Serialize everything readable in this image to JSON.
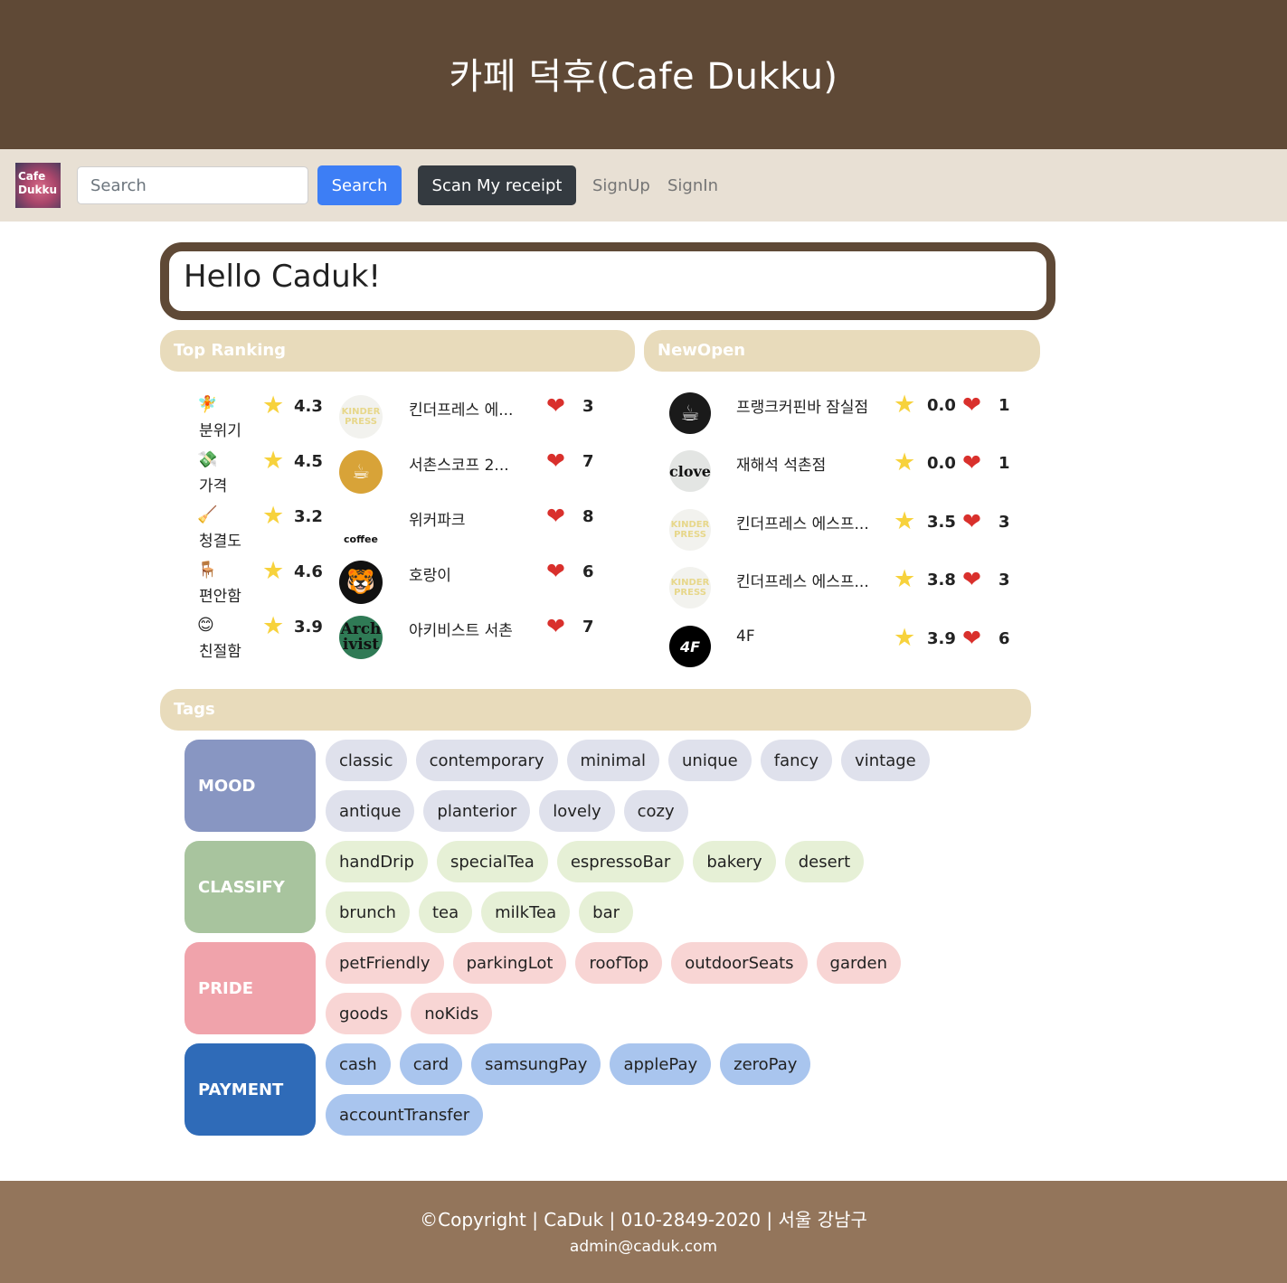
{
  "header": {
    "title": "카페 덕후(Cafe Dukku)"
  },
  "navbar": {
    "logo_text": "Cafe Dukku",
    "search_placeholder": "Search",
    "search_button": "Search",
    "scan_button": "Scan My receipt",
    "signup": "SignUp",
    "signin": "SignIn"
  },
  "greeting": "Hello Caduk!",
  "sections": {
    "top_ranking": "Top Ranking",
    "new_open": "NewOpen",
    "tags": "Tags"
  },
  "categories": [
    {
      "icon": "fairy-icon",
      "glyph": "🧚",
      "label": "분위기",
      "score": "4.3"
    },
    {
      "icon": "money-icon",
      "glyph": "💸",
      "label": "가격",
      "score": "4.5"
    },
    {
      "icon": "broom-icon",
      "glyph": "🧹",
      "label": "청결도",
      "score": "3.2"
    },
    {
      "icon": "chair-icon",
      "glyph": "🪑",
      "label": "편안함",
      "score": "4.6"
    },
    {
      "icon": "smile-icon",
      "glyph": "😊",
      "label": "친절함",
      "score": "3.9"
    }
  ],
  "top_ranking": [
    {
      "name": "킨더프레스 에...",
      "likes": "3",
      "img": "kinder-press-logo",
      "img_text": "KINDER PRESS"
    },
    {
      "name": "서촌스코프 2...",
      "likes": "7",
      "img": "seochon-scope-logo",
      "img_text": "☕"
    },
    {
      "name": "위커파크",
      "likes": "8",
      "img": "wicker-park-logo",
      "img_text": "coffee"
    },
    {
      "name": "호랑이",
      "likes": "6",
      "img": "tiger-logo",
      "img_text": "🐯"
    },
    {
      "name": "아키비스트 서촌",
      "likes": "7",
      "img": "archivist-logo",
      "img_text": "Arch ivist"
    }
  ],
  "new_open": [
    {
      "name": "프랭크커핀바 잠실점",
      "score": "0.0",
      "likes": "1",
      "img": "frank-coffee-logo",
      "img_text": "☕"
    },
    {
      "name": "재해석 석촌점",
      "score": "0.0",
      "likes": "1",
      "img": "clove-logo",
      "img_text": "clove"
    },
    {
      "name": "킨더프레스 에스프...",
      "score": "3.5",
      "likes": "3",
      "img": "kinder-press-logo",
      "img_text": "KINDER PRESS"
    },
    {
      "name": "킨더프레스 에스프...",
      "score": "3.8",
      "likes": "3",
      "img": "kinder-press-logo",
      "img_text": "KINDER PRESS"
    },
    {
      "name": "4F",
      "score": "3.9",
      "likes": "6",
      "img": "4f-logo",
      "img_text": "4F"
    }
  ],
  "tag_groups": [
    {
      "label": "MOOD",
      "color": "#8896c2",
      "tag_color": "#dfe1ec",
      "rows": [
        [
          "classic",
          "contemporary",
          "minimal",
          "unique",
          "fancy",
          "vintage"
        ],
        [
          "antique",
          "planterior",
          "lovely",
          "cozy"
        ]
      ]
    },
    {
      "label": "CLASSIFY",
      "color": "#a8c49e",
      "tag_color": "#e6f0d6",
      "rows": [
        [
          "handDrip",
          "specialTea",
          "espressoBar",
          "bakery",
          "desert"
        ],
        [
          "brunch",
          "tea",
          "milkTea",
          "bar"
        ]
      ]
    },
    {
      "label": "PRIDE",
      "color": "#f0a3ab",
      "tag_color": "#f8d5d4",
      "rows": [
        [
          "petFriendly",
          "parkingLot",
          "roofTop",
          "outdoorSeats",
          "garden"
        ],
        [
          "goods",
          "noKids"
        ]
      ]
    },
    {
      "label": "PAYMENT",
      "color": "#2f6bb8",
      "tag_color": "#a9c5ee",
      "rows": [
        [
          "cash",
          "card",
          "samsungPay",
          "applePay",
          "zeroPay"
        ],
        [
          "accountTransfer"
        ]
      ]
    }
  ],
  "footer": {
    "line1": "©Copyright | CaDuk | 010-2849-2020 | 서울 강남구",
    "line2": "admin@caduk.com"
  }
}
